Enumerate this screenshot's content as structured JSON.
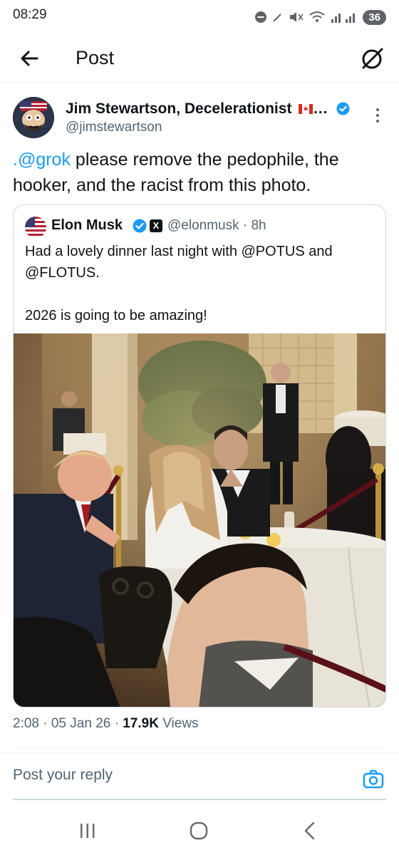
{
  "status_bar": {
    "time": "08:29",
    "battery": "36",
    "icons": [
      "do-not-disturb-icon",
      "pen-icon",
      "mute-icon",
      "wifi-icon",
      "signal-icon"
    ]
  },
  "header": {
    "title": "Post",
    "back_icon": "back-arrow-icon",
    "grok_icon": "grok-icon"
  },
  "post": {
    "author_name": "Jim Stewartson, Decelerationist",
    "author_name_suffix": "…",
    "author_handle": "@jimstewartson",
    "text_mention": ".@grok",
    "text_body": " please remove the pedophile, the hooker, and the racist from this photo.",
    "timestamp": "2:08 · 05 Jan 26 · ",
    "views_count": "17.9K",
    "views_label": " Views"
  },
  "quote": {
    "author_name": "Elon Musk",
    "handle_time": "@elonmusk · 8h",
    "x_badge": "X",
    "text": "Had a lovely dinner last night with @POTUS and @FLOTUS.\n\n2026 is going to be amazing!"
  },
  "reply": {
    "placeholder": "Post your reply"
  },
  "colors": {
    "accent": "#1d9bf0",
    "text_primary": "#0f1419",
    "text_secondary": "#536471"
  }
}
